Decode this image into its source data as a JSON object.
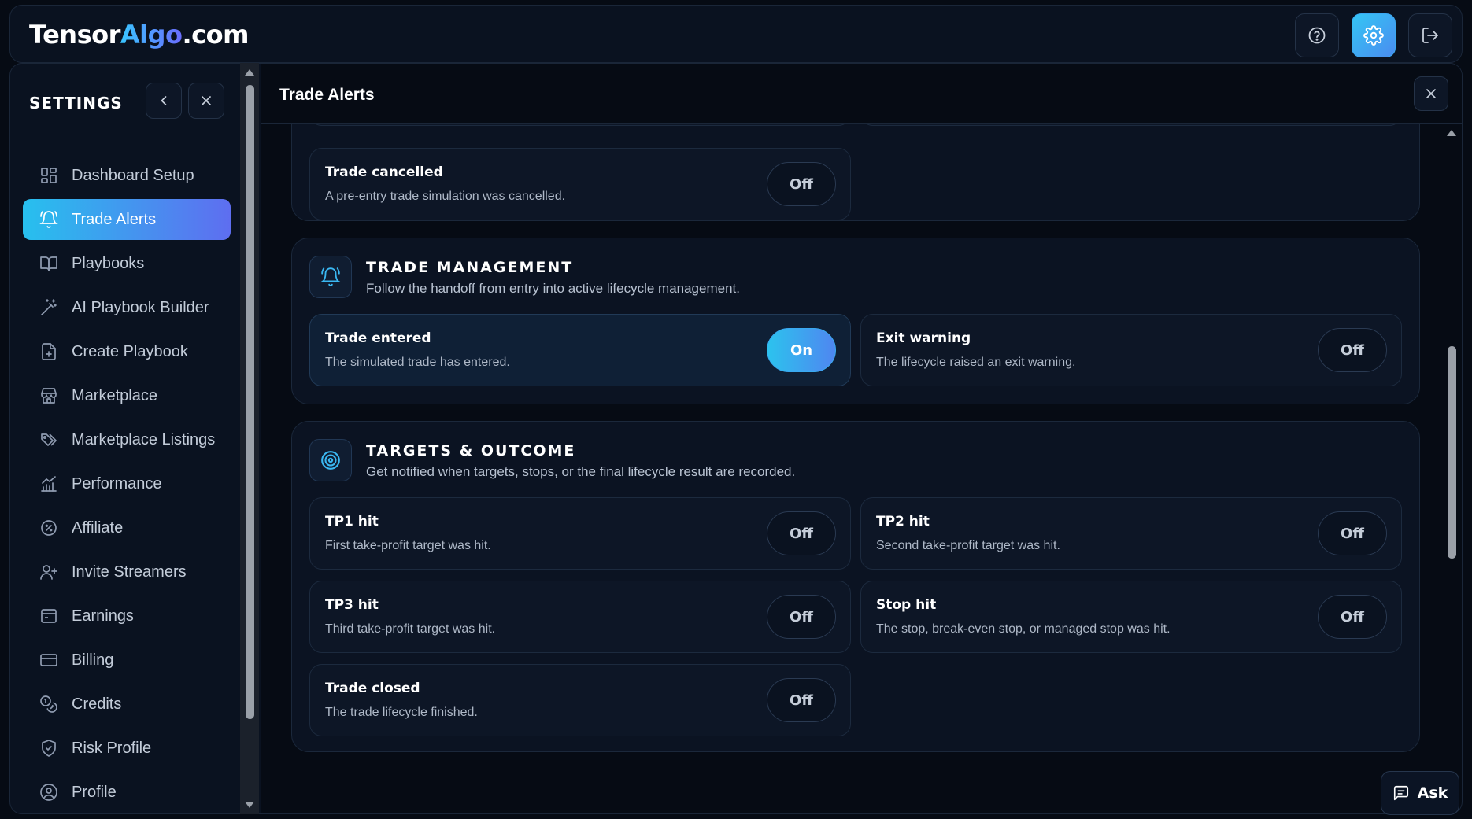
{
  "app": {
    "logo_part1": "Tensor",
    "logo_part2": "Algo",
    "logo_part3": ".com",
    "top_icons": [
      "help-circle-icon",
      "gear-icon",
      "logout-icon"
    ]
  },
  "sidebar": {
    "title": "SETTINGS",
    "items": [
      {
        "label": "Dashboard Setup",
        "icon": "dashboard-grid-icon",
        "active": false
      },
      {
        "label": "Trade Alerts",
        "icon": "bell-icon",
        "active": true
      },
      {
        "label": "Playbooks",
        "icon": "book-icon",
        "active": false
      },
      {
        "label": "AI Playbook Builder",
        "icon": "magic-wand-icon",
        "active": false
      },
      {
        "label": "Create Playbook",
        "icon": "file-plus-icon",
        "active": false
      },
      {
        "label": "Marketplace",
        "icon": "store-icon",
        "active": false
      },
      {
        "label": "Marketplace Listings",
        "icon": "tags-icon",
        "active": false
      },
      {
        "label": "Performance",
        "icon": "bar-chart-icon",
        "active": false
      },
      {
        "label": "Affiliate",
        "icon": "badge-percent-icon",
        "active": false
      },
      {
        "label": "Invite Streamers",
        "icon": "user-plus-icon",
        "active": false
      },
      {
        "label": "Earnings",
        "icon": "wallet-icon",
        "active": false
      },
      {
        "label": "Billing",
        "icon": "credit-card-icon",
        "active": false
      },
      {
        "label": "Credits",
        "icon": "coins-icon",
        "active": false
      },
      {
        "label": "Risk Profile",
        "icon": "shield-check-icon",
        "active": false
      },
      {
        "label": "Profile",
        "icon": "user-circle-icon",
        "active": false
      }
    ]
  },
  "main": {
    "title": "Trade Alerts",
    "sections": {
      "first": {
        "cards": [
          {
            "title": "Trade cancelled",
            "desc": "A pre-entry trade simulation was cancelled.",
            "state": "Off"
          }
        ]
      },
      "trade_management": {
        "title": "TRADE MANAGEMENT",
        "desc": "Follow the handoff from entry into active lifecycle management.",
        "icon": "bell-icon",
        "cards": [
          {
            "title": "Trade entered",
            "desc": "The simulated trade has entered.",
            "state": "On"
          },
          {
            "title": "Exit warning",
            "desc": "The lifecycle raised an exit warning.",
            "state": "Off"
          }
        ]
      },
      "targets": {
        "title": "TARGETS & OUTCOME",
        "desc": "Get notified when targets, stops, or the final lifecycle result are recorded.",
        "icon": "target-icon",
        "cards": [
          {
            "title": "TP1 hit",
            "desc": "First take-profit target was hit.",
            "state": "Off"
          },
          {
            "title": "TP2 hit",
            "desc": "Second take-profit target was hit.",
            "state": "Off"
          },
          {
            "title": "TP3 hit",
            "desc": "Third take-profit target was hit.",
            "state": "Off"
          },
          {
            "title": "Stop hit",
            "desc": "The stop, break-even stop, or managed stop was hit.",
            "state": "Off"
          },
          {
            "title": "Trade closed",
            "desc": "The trade lifecycle finished.",
            "state": "Off"
          }
        ]
      }
    }
  },
  "ask_button": {
    "label": "Ask",
    "icon": "chat-icon"
  },
  "colors": {
    "accent_start": "#27c0ee",
    "accent_end": "#5e6ef0",
    "background": "#060b14",
    "panel": "#0a1220"
  }
}
